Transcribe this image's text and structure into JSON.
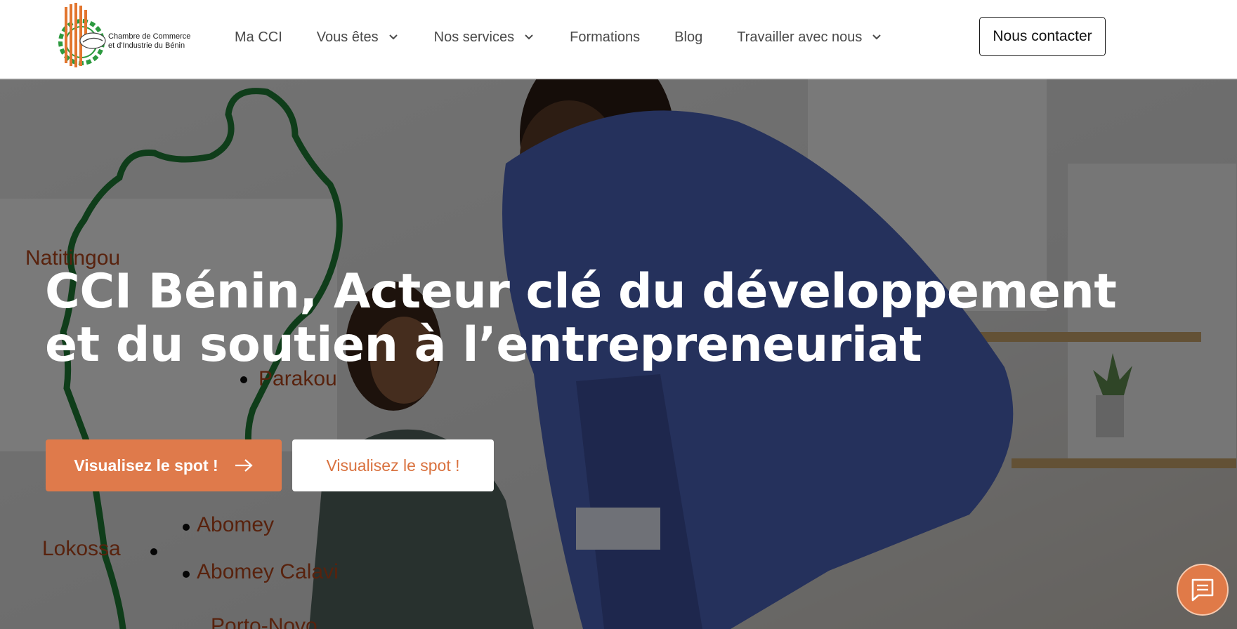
{
  "header": {
    "logo": {
      "line1": "Chambre de Commerce",
      "line2": "et d'Industrie du Bénin"
    },
    "nav": [
      {
        "label": "Ma CCI",
        "has_dropdown": false
      },
      {
        "label": "Vous êtes",
        "has_dropdown": true
      },
      {
        "label": "Nos services",
        "has_dropdown": true
      },
      {
        "label": "Formations",
        "has_dropdown": false
      },
      {
        "label": "Blog",
        "has_dropdown": false
      },
      {
        "label": "Travailler avec nous",
        "has_dropdown": true
      }
    ],
    "contact_label": "Nous contacter"
  },
  "hero": {
    "title_line1": "CCI Bénin, Acteur clé du développement",
    "title_line2": "et du soutien à l’entrepreneuriat",
    "primary_button": "Visualisez le spot !",
    "secondary_button": "Visualisez le spot !",
    "map_labels": {
      "natitingou": "Natitingou",
      "parakou": "Parakou",
      "abomey": "Abomey",
      "lokossa": "Lokossa",
      "abomey_calavi": "Abomey Calavi",
      "porto_novo": "Porto-Novo"
    }
  },
  "icons": {
    "chevron": "chevron-down-icon",
    "arrow": "arrow-right-icon",
    "chat": "chat-icon"
  },
  "colors": {
    "accent": "#df7a4b",
    "accent_text": "#d9723f",
    "map_outline": "#1f7a35",
    "map_label": "#b0441b",
    "jacket_blue": "#4a62b8"
  }
}
